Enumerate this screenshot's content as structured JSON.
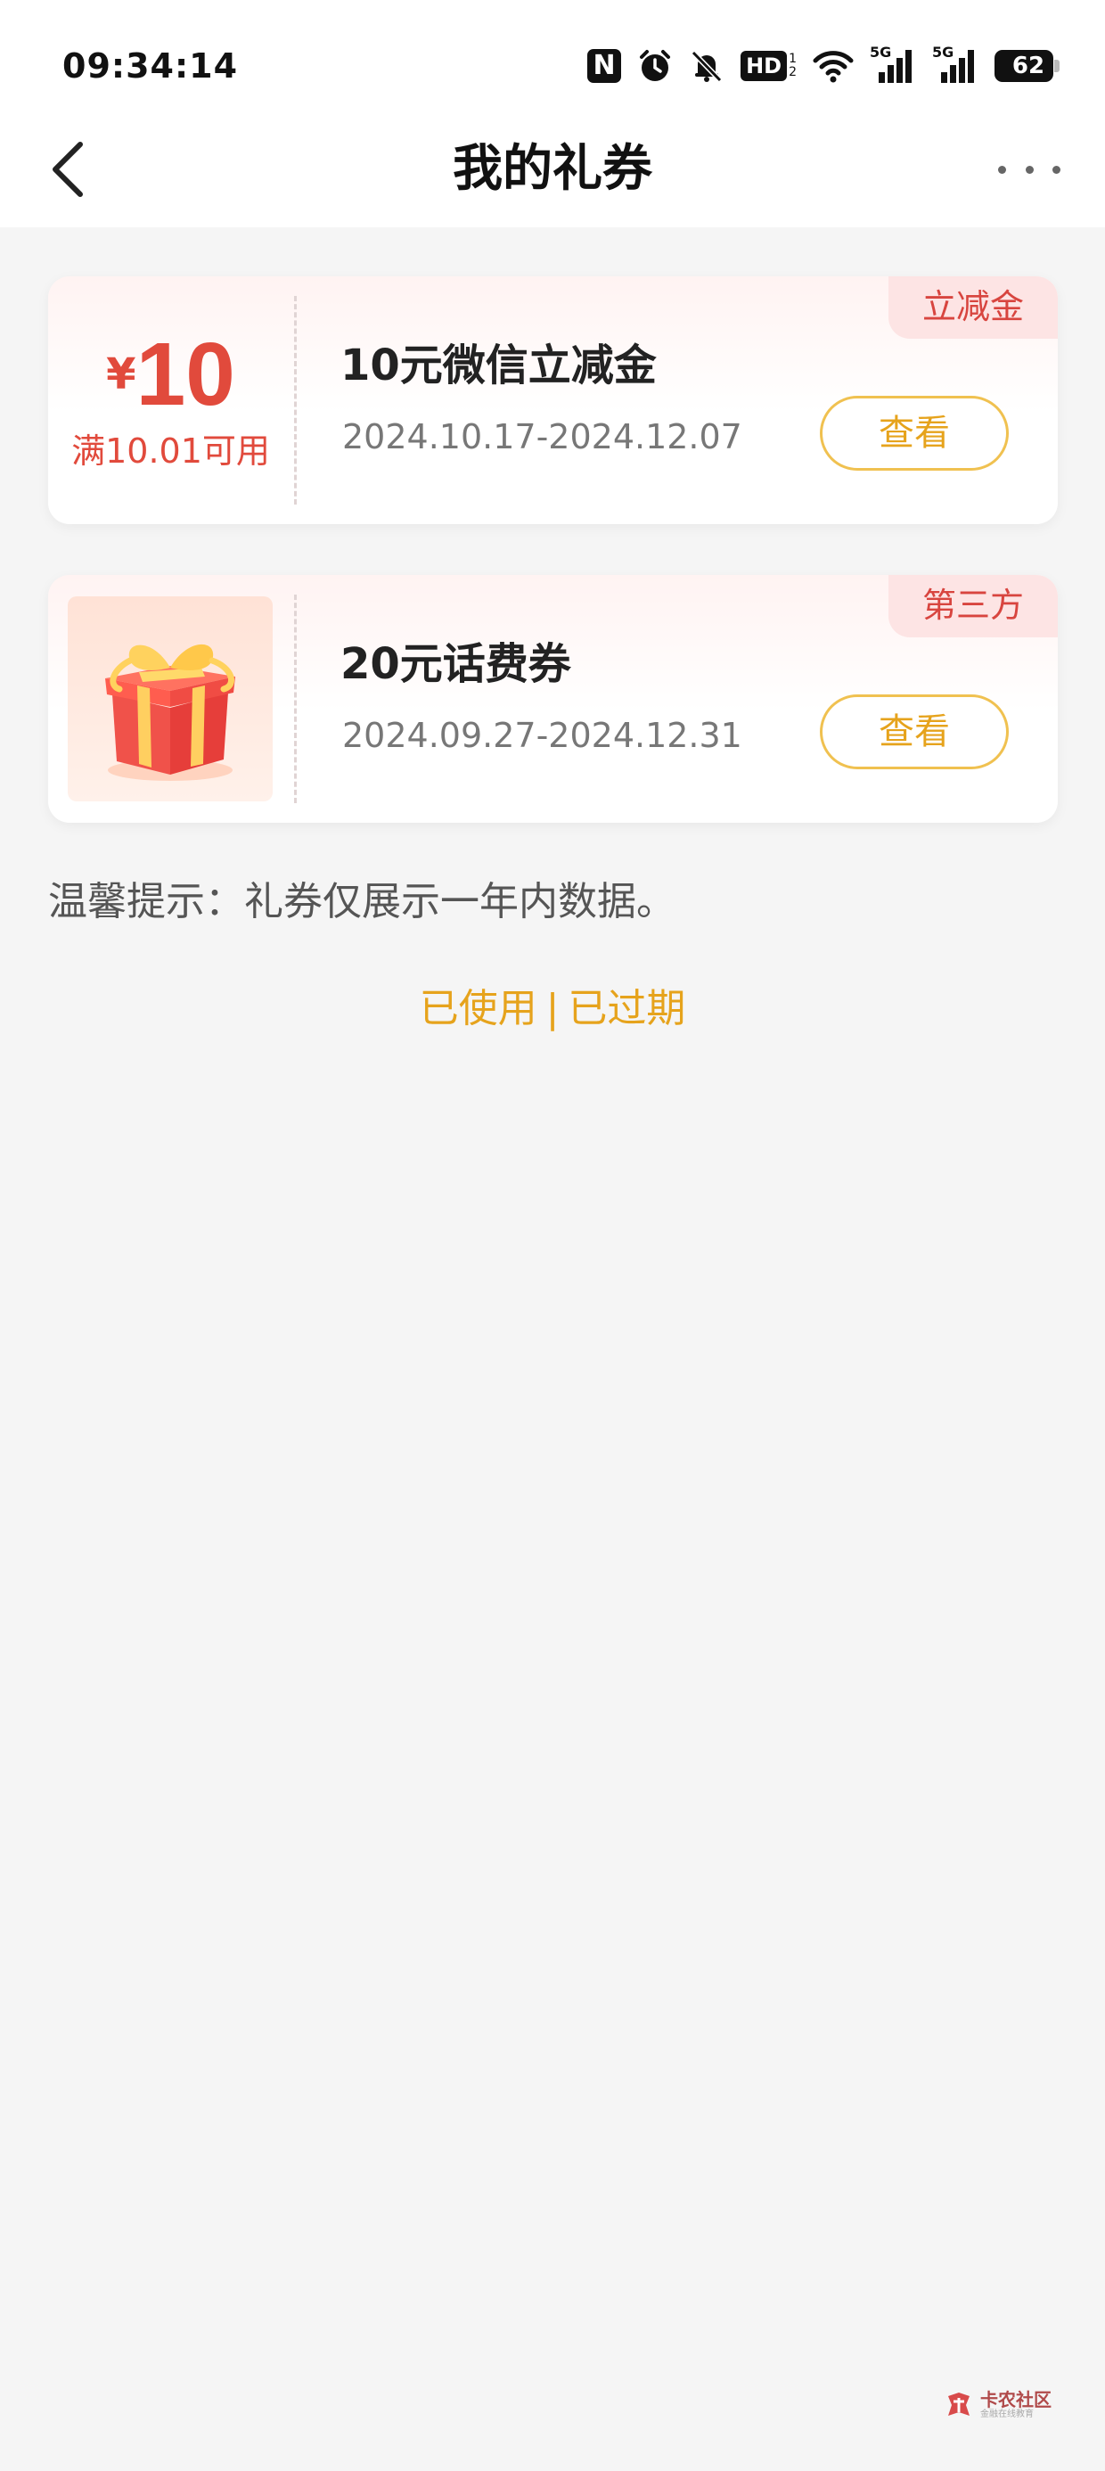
{
  "status_bar": {
    "time": "09:34:14",
    "nfc_label": "N",
    "hd_label": "HD",
    "hd_sub": [
      "1",
      "2"
    ],
    "signal_label_1": "5G",
    "signal_label_2": "5G",
    "battery": "62"
  },
  "header": {
    "title": "我的礼券"
  },
  "coupons": [
    {
      "tag": "立减金",
      "currency": "¥",
      "amount": "10",
      "condition": "满10.01可用",
      "title": "10元微信立减金",
      "date_range": "2024.10.17-2024.12.07",
      "button_label": "查看"
    },
    {
      "tag": "第三方",
      "image": "gift-box",
      "title": "20元话费券",
      "date_range": "2024.09.27-2024.12.31",
      "button_label": "查看"
    }
  ],
  "tip": "温馨提示：礼券仅展示一年内数据。",
  "history": {
    "used": "已使用",
    "separator": "|",
    "expired": "已过期"
  },
  "watermark": {
    "main": "卡农社区",
    "sub": "金融在线教育"
  },
  "colors": {
    "accent_red": "#e14a3c",
    "accent_gold": "#e6a31c",
    "tag_bg": "#fde4e4",
    "page_bg": "#f5f5f5"
  }
}
